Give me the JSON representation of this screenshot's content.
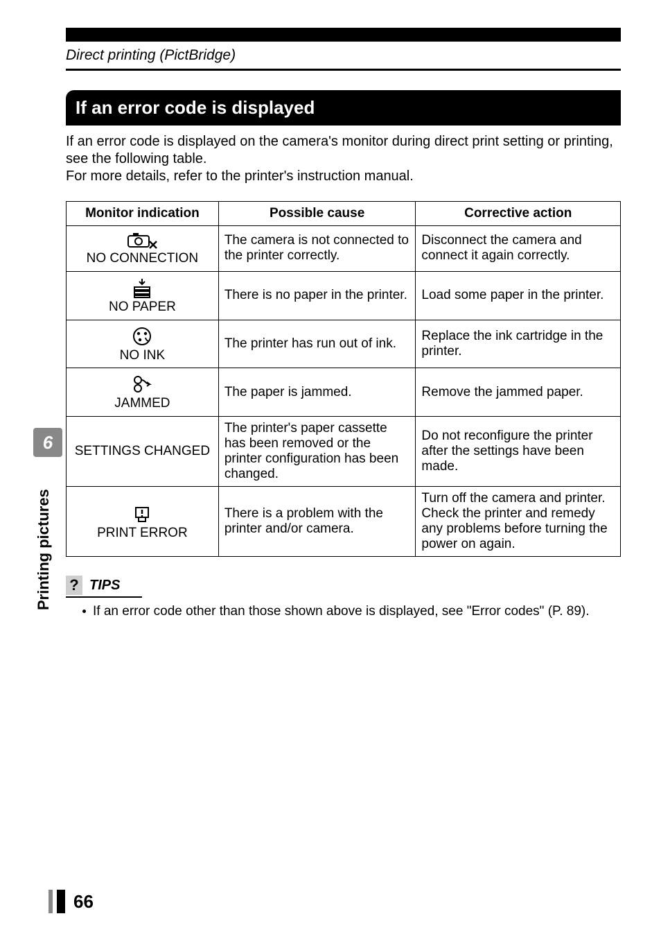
{
  "section_header": "Direct printing (PictBridge)",
  "banner": "If an error code is displayed",
  "intro_line1": "If an error code is displayed on the camera's monitor during direct print setting or printing, see the following table.",
  "intro_line2": "For more details, refer to the printer's instruction manual.",
  "table": {
    "headers": {
      "monitor": "Monitor indication",
      "cause": "Possible cause",
      "action": "Corrective action"
    },
    "rows": [
      {
        "icon": "camera-x-icon",
        "monitor_text": "NO CONNECTION",
        "cause": "The camera is not connected to the printer correctly.",
        "action": "Disconnect the camera and connect it again correctly."
      },
      {
        "icon": "no-paper-icon",
        "monitor_text": "NO PAPER",
        "cause": "There is no paper in the printer.",
        "action": "Load some paper in the printer."
      },
      {
        "icon": "no-ink-icon",
        "monitor_text": "NO INK",
        "cause": "The printer has run out of ink.",
        "action": "Replace the ink cartridge in the printer."
      },
      {
        "icon": "jammed-icon",
        "monitor_text": "JAMMED",
        "cause": "The paper is jammed.",
        "action": "Remove the jammed paper."
      },
      {
        "icon": "",
        "monitor_text": "SETTINGS CHANGED",
        "cause": "The printer's paper cassette has been removed or the printer configuration has been changed.",
        "action": "Do not reconfigure the printer after the settings have been made."
      },
      {
        "icon": "print-error-icon",
        "monitor_text": "PRINT ERROR",
        "cause": "There is a problem with the printer and/or camera.",
        "action": "Turn off the camera and printer. Check the printer and remedy any problems before turning the power on again."
      }
    ]
  },
  "tips": {
    "q": "?",
    "label": "TIPS",
    "bullet": "If an error code other than those shown above is displayed, see \"Error codes\" (P. 89)."
  },
  "side_tab": "6",
  "side_label": "Printing pictures",
  "page_number": "66"
}
